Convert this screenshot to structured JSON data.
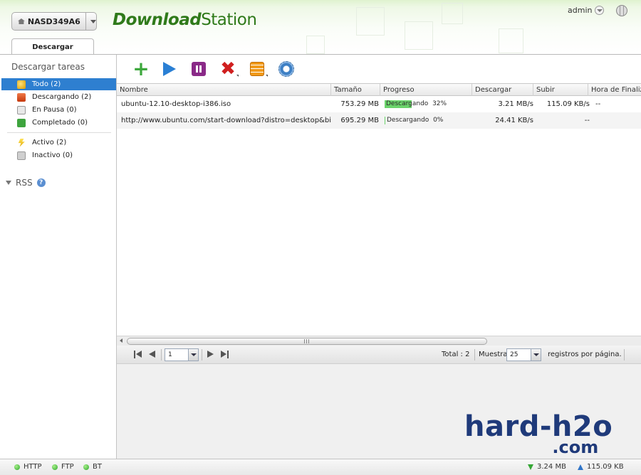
{
  "header": {
    "device_name": "NASD349A6",
    "app_title_bold": "Download",
    "app_title_regular": "Station",
    "user": "admin"
  },
  "tabs": [
    {
      "label": "Descargar",
      "active": true
    }
  ],
  "sidebar": {
    "section_title": "Descargar tareas",
    "items": [
      {
        "label": "Todo (2)",
        "icon": "all-tasks-icon",
        "selected": true
      },
      {
        "label": "Descargando (2)",
        "icon": "downloading-icon",
        "selected": false
      },
      {
        "label": "En Pausa (0)",
        "icon": "paused-icon",
        "selected": false
      },
      {
        "label": "Completado (0)",
        "icon": "completed-icon",
        "selected": false
      },
      {
        "label": "Activo (2)",
        "icon": "active-icon",
        "selected": false
      },
      {
        "label": "Inactivo (0)",
        "icon": "inactive-icon",
        "selected": false
      }
    ],
    "rss_label": "RSS"
  },
  "toolbar": {
    "buttons": [
      "add-icon",
      "start-icon",
      "pause-icon",
      "delete-icon",
      "tasks-icon",
      "settings-icon"
    ]
  },
  "grid": {
    "columns": [
      "Nombre",
      "Tamaño",
      "Progreso",
      "Descargar",
      "Subir",
      "Hora de Finaliz"
    ],
    "rows": [
      {
        "name": "ubuntu-12.10-desktop-i386.iso",
        "size": "753.29 MB",
        "status": "Descargando",
        "percent": "32%",
        "progress": 0.32,
        "download": "3.21 MB/s",
        "upload": "115.09 KB/s",
        "eta": "--"
      },
      {
        "name": "http://www.ubuntu.com/start-download?distro=desktop&bits",
        "size": "695.29 MB",
        "status": "Descargando",
        "percent": "0%",
        "progress": 0.0,
        "download": "24.41 KB/s",
        "upload": "--",
        "eta": ""
      }
    ]
  },
  "pager": {
    "page": "1",
    "total": "Total : 2",
    "show_label": "Muestra",
    "per_page": "25",
    "per_page_suffix": "registros por página."
  },
  "watermark": {
    "line1": "hard-h2o",
    "line2": ".com"
  },
  "statusbar": {
    "protocols": [
      "HTTP",
      "FTP",
      "BT"
    ],
    "download_total": "3.24 MB",
    "upload_total": "115.09 KB"
  },
  "colors": {
    "accent_green": "#2f7a1a",
    "selection_blue": "#2e7fd0",
    "progress_green": "#6bd36b"
  }
}
